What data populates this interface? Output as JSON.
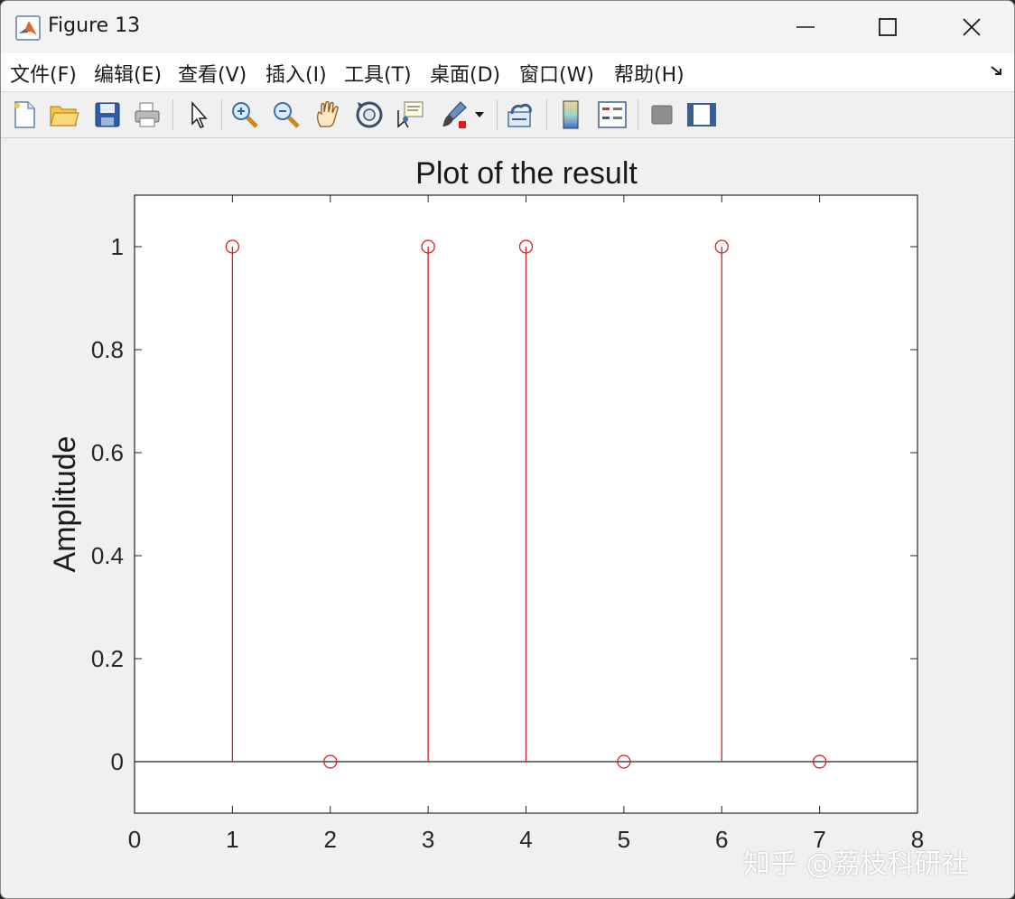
{
  "window": {
    "title": "Figure 13"
  },
  "menu": [
    {
      "label": "文件(F)"
    },
    {
      "label": "编辑(E)"
    },
    {
      "label": "查看(V)"
    },
    {
      "label": "插入(I)"
    },
    {
      "label": "工具(T)"
    },
    {
      "label": "桌面(D)"
    },
    {
      "label": "窗口(W)"
    },
    {
      "label": "帮助(H)"
    }
  ],
  "toolbar": {
    "icons": [
      "new-figure-icon",
      "open-file-icon",
      "save-icon",
      "print-icon",
      "pointer-icon",
      "zoom-in-icon",
      "zoom-out-icon",
      "pan-icon",
      "rotate-3d-icon",
      "data-cursor-icon",
      "brush-icon",
      "brush-dropdown-icon",
      "link-plot-icon",
      "colorbar-icon",
      "legend-icon",
      "hide-plot-tools-icon",
      "show-plot-tools-icon"
    ]
  },
  "watermark": "知乎 @荔枝科研社",
  "colors": {
    "stem": "#d62020",
    "baseline": "#202020",
    "axes_bg": "#ffffff",
    "figure_bg": "#f0f0f0"
  },
  "chart_data": {
    "type": "stem",
    "title": "Plot of the result",
    "xlabel": "",
    "ylabel": "Amplitude",
    "xlim": [
      0,
      8
    ],
    "ylim": [
      -0.1,
      1.1
    ],
    "xticks": [
      "0",
      "1",
      "2",
      "3",
      "4",
      "5",
      "6",
      "7",
      "8"
    ],
    "yticks": [
      "0",
      "0.2",
      "0.4",
      "0.6",
      "0.8",
      "1"
    ],
    "x": [
      1,
      2,
      3,
      4,
      5,
      6,
      7
    ],
    "values": [
      1,
      0,
      1,
      1,
      0,
      1,
      0
    ],
    "grid": false,
    "baseline": 0
  }
}
